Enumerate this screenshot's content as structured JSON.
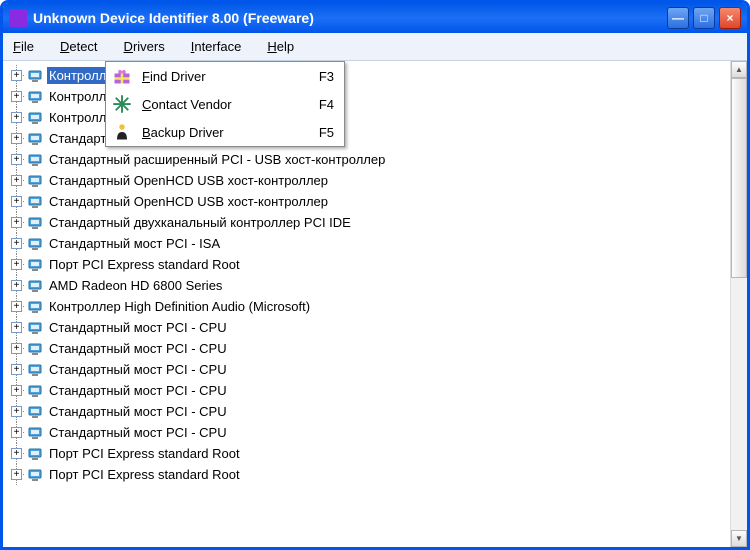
{
  "window": {
    "title": "Unknown Device Identifier 8.00 (Freeware)"
  },
  "menubar": {
    "file": "File",
    "detect": "Detect",
    "drivers": "Drivers",
    "interface": "Interface",
    "help": "Help"
  },
  "context_menu": {
    "find_driver": {
      "label": "Find Driver",
      "shortcut": "F3"
    },
    "contact_vendor": {
      "label": "Contact Vendor",
      "shortcut": "F4"
    },
    "backup_driver": {
      "label": "Backup Driver",
      "shortcut": "F5"
    }
  },
  "tree": {
    "items": [
      {
        "label": "Контролл"
      },
      {
        "label": "Контролл                                               ными ввода-вывода ATI"
      },
      {
        "label": "Контролл                                               ии ввода-вывода ATI"
      },
      {
        "label": "Стандарт                                               DE"
      },
      {
        "label": "Стандартный расширенный PCI - USB хост-контроллер"
      },
      {
        "label": "Стандартный OpenHCD USB хост-контроллер"
      },
      {
        "label": "Стандартный OpenHCD USB хост-контроллер"
      },
      {
        "label": "Стандартный двухканальный контроллер PCI IDE"
      },
      {
        "label": "Стандартный мост PCI - ISA"
      },
      {
        "label": "Порт PCI Express standard Root"
      },
      {
        "label": "AMD Radeon HD 6800 Series"
      },
      {
        "label": "Контроллер High Definition Audio (Microsoft)"
      },
      {
        "label": "Стандартный мост PCI  - CPU"
      },
      {
        "label": "Стандартный мост PCI  - CPU"
      },
      {
        "label": "Стандартный мост PCI  - CPU"
      },
      {
        "label": "Стандартный мост PCI  - CPU"
      },
      {
        "label": "Стандартный мост PCI  - CPU"
      },
      {
        "label": "Стандартный мост PCI  - CPU"
      },
      {
        "label": "Порт PCI Express standard Root"
      },
      {
        "label": "Порт PCI Express standard Root"
      }
    ]
  }
}
